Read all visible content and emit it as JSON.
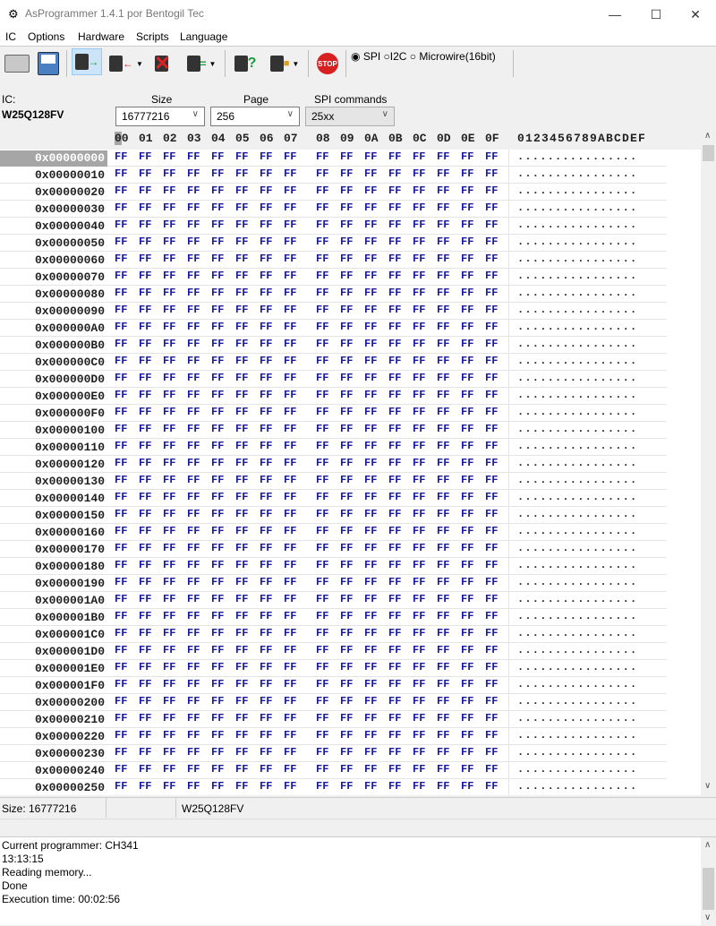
{
  "window": {
    "title": "AsProgrammer 1.4.1 por Bentogil Tec",
    "minimize": "—",
    "maximize": "☐",
    "close": "✕"
  },
  "menu": [
    "IC",
    "Options",
    "Hardware",
    "Scripts",
    "Language"
  ],
  "toolbar": {
    "stop_label": "STOP",
    "protocols": [
      {
        "label": "SPI",
        "checked": true
      },
      {
        "label": "I2C",
        "checked": false
      },
      {
        "label": "Microwire(16bit)",
        "checked": false
      }
    ]
  },
  "ic": {
    "label": "IC:",
    "name": "W25Q128FV"
  },
  "size": {
    "label": "Size",
    "value": "16777216"
  },
  "page": {
    "label": "Page",
    "value": "256"
  },
  "spi": {
    "label": "SPI commands",
    "value": "25xx"
  },
  "hex_header": {
    "columns": [
      "00",
      "01",
      "02",
      "03",
      "04",
      "05",
      "06",
      "07",
      "08",
      "09",
      "0A",
      "0B",
      "0C",
      "0D",
      "0E",
      "0F"
    ],
    "ascii": "0123456789ABCDEF"
  },
  "rows": [
    {
      "addr": "0x00000000"
    },
    {
      "addr": "0x00000010"
    },
    {
      "addr": "0x00000020"
    },
    {
      "addr": "0x00000030"
    },
    {
      "addr": "0x00000040"
    },
    {
      "addr": "0x00000050"
    },
    {
      "addr": "0x00000060"
    },
    {
      "addr": "0x00000070"
    },
    {
      "addr": "0x00000080"
    },
    {
      "addr": "0x00000090"
    },
    {
      "addr": "0x000000A0"
    },
    {
      "addr": "0x000000B0"
    },
    {
      "addr": "0x000000C0"
    },
    {
      "addr": "0x000000D0"
    },
    {
      "addr": "0x000000E0"
    },
    {
      "addr": "0x000000F0"
    },
    {
      "addr": "0x00000100"
    },
    {
      "addr": "0x00000110"
    },
    {
      "addr": "0x00000120"
    },
    {
      "addr": "0x00000130"
    },
    {
      "addr": "0x00000140"
    },
    {
      "addr": "0x00000150"
    },
    {
      "addr": "0x00000160"
    },
    {
      "addr": "0x00000170"
    },
    {
      "addr": "0x00000180"
    },
    {
      "addr": "0x00000190"
    },
    {
      "addr": "0x000001A0"
    },
    {
      "addr": "0x000001B0"
    },
    {
      "addr": "0x000001C0"
    },
    {
      "addr": "0x000001D0"
    },
    {
      "addr": "0x000001E0"
    },
    {
      "addr": "0x000001F0"
    },
    {
      "addr": "0x00000200"
    },
    {
      "addr": "0x00000210"
    },
    {
      "addr": "0x00000220"
    },
    {
      "addr": "0x00000230"
    },
    {
      "addr": "0x00000240"
    },
    {
      "addr": "0x00000250"
    }
  ],
  "row_bytes": "FF FF FF FF FF FF FF FF FF FF FF FF FF FF FF FF",
  "row_ascii": "................",
  "status": {
    "size": "Size: 16777216",
    "ic": "W25Q128FV"
  },
  "log": [
    "Current programmer: CH341",
    "13:13:15",
    "Reading memory...",
    "Done",
    "Execution time: 00:02:56"
  ]
}
